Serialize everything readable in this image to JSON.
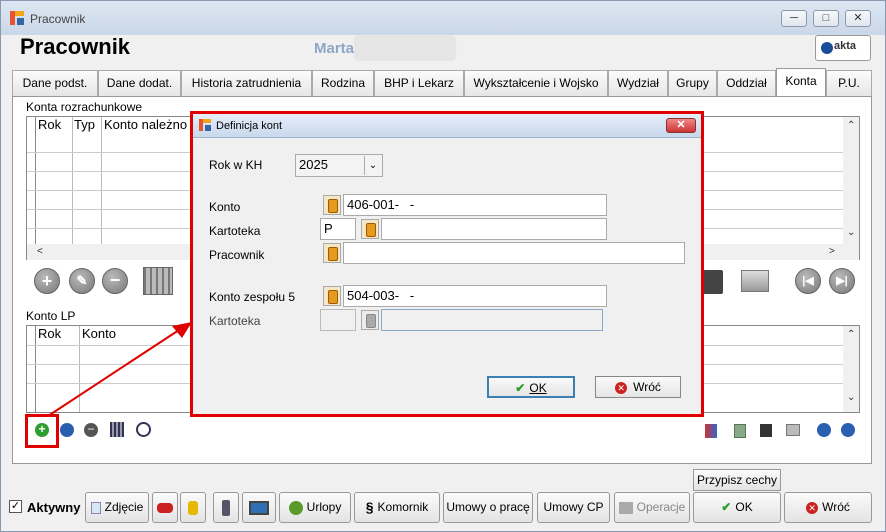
{
  "window": {
    "title": "Pracownik",
    "controls": [
      "minimize",
      "restore",
      "close"
    ]
  },
  "header": {
    "title": "Pracownik",
    "employee_name": "Marta",
    "logo_text": "akta"
  },
  "tabs": [
    {
      "label": "Dane podst.",
      "active": false
    },
    {
      "label": "Dane dodat.",
      "active": false
    },
    {
      "label": "Historia zatrudnienia",
      "active": false
    },
    {
      "label": "Rodzina",
      "active": false
    },
    {
      "label": "BHP i Lekarz",
      "active": false
    },
    {
      "label": "Wykształcenie i Wojsko",
      "active": false
    },
    {
      "label": "Wydział",
      "active": false
    },
    {
      "label": "Grupy",
      "active": false
    },
    {
      "label": "Oddział",
      "active": false
    },
    {
      "label": "Konta",
      "active": true
    },
    {
      "label": "P.U.",
      "active": false
    }
  ],
  "accounts_section": {
    "label": "Konta rozrachunkowe",
    "columns": [
      "Rok",
      "Typ",
      "Konto należno"
    ]
  },
  "lp_section": {
    "label": "Konto LP",
    "columns": [
      "Rok",
      "Konto"
    ]
  },
  "dialog": {
    "title": "Definicja kont",
    "year_label": "Rok w KH",
    "year_value": "2025",
    "konto_label": "Konto",
    "konto_value": "406-001-   -",
    "kartoteka_label": "Kartoteka",
    "kartoteka_value": "P",
    "pracownik_label": "Pracownik",
    "pracownik_value": "",
    "konto_zespolu_label": "Konto zespołu 5",
    "konto_zespolu_value": "504-003-   -",
    "kartoteka2_label": "Kartoteka",
    "ok_label": "OK",
    "back_label": "Wróć"
  },
  "bottom": {
    "przypisz_label": "Przypisz cechy",
    "aktywny_label": "Aktywny",
    "aktywny_checked": true,
    "buttons": {
      "zdjecie": "Zdjęcie",
      "urlopy": "Urlopy",
      "komornik": "Komornik",
      "umowy_prace": "Umowy o pracę",
      "umowy_cp": "Umowy CP",
      "operacje": "Operacje",
      "ok": "OK",
      "wroc": "Wróć"
    }
  },
  "colors": {
    "highlight": "#e00000",
    "accent": "#1a4d99"
  }
}
